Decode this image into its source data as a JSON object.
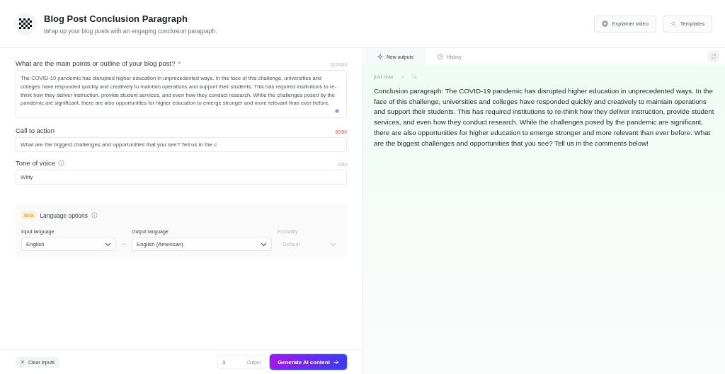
{
  "header": {
    "title": "Blog Post Conclusion Paragraph",
    "subtitle": "Wrap up your blog posts with an engaging conclusion paragraph.",
    "buttons": [
      {
        "kind": "video",
        "label": "Explainer video"
      },
      {
        "kind": "templates",
        "label": "Templates"
      }
    ]
  },
  "fields": [
    {
      "kind": "textarea",
      "label": "What are the main points or outline of your blog post?",
      "required_mark": "*",
      "info": false,
      "counter": "522/600",
      "limit_reached": false,
      "value": "The COVID-19 pandemic has disrupted higher education in unprecedented ways. In the face of this challenge, universities and colleges have responded quickly and creatively to maintain operations and support their students. This has required institutions to re-think how they deliver instruction, provide student services, and even how they conduct research. While the challenges posed by the pandemic are significant, there are also opportunities for higher education to emerge stronger and more relevant than ever before."
    },
    {
      "kind": "input",
      "label": "Call to action",
      "info": false,
      "counter": "80/80",
      "limit_reached": true,
      "value": "What are the biggest challenges and opportunities that you see? Tell us in the c"
    },
    {
      "kind": "input",
      "label": "Tone of voice",
      "info": true,
      "counter": "6/80",
      "limit_reached": false,
      "value": "Witty"
    }
  ],
  "language_options": {
    "badge": "Beta",
    "title": "Language options",
    "selects": [
      {
        "label": "Input language",
        "value": "English",
        "disabled": false
      },
      {
        "label": "Output language",
        "value": "English (American)",
        "disabled": false
      },
      {
        "label": "Formality",
        "value": "Default",
        "disabled": true
      }
    ]
  },
  "footer": {
    "clear_button": "Clear inputs",
    "output_count": "1",
    "output_label": "Output",
    "generate_button": "Generate AI content"
  },
  "tabs": [
    {
      "label": "New outputs",
      "kind": "sparkle",
      "selected": true
    },
    {
      "label": "History",
      "kind": "clock",
      "selected": false
    }
  ],
  "output": {
    "time": "just now",
    "text": "Conclusion paragraph: The COVID-19 pandemic has disrupted higher education in unprecedented ways. In the face of this challenge, universities and colleges have responded quickly and creatively to maintain operations and support their students. This has required institutions to re-think how they deliver instruction, provide student services, and even how they conduct research. While the challenges posed by the pandemic are significant, there are also opportunities for higher education to emerge stronger and more relevant than ever before. What are the biggest challenges and opportunities that you see? Tell us in the comments below!"
  }
}
